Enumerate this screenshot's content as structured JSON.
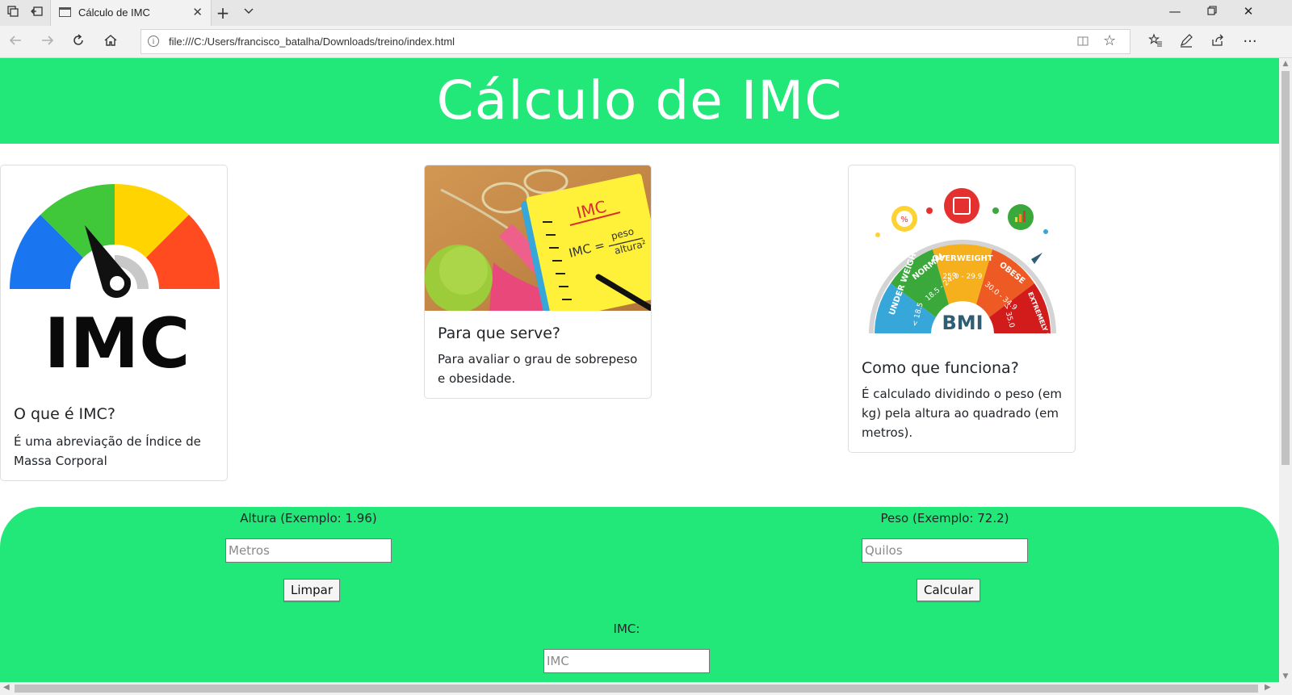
{
  "browser": {
    "tab_title": "Cálculo de IMC",
    "url": "file:///C:/Users/francisco_batalha/Downloads/treino/index.html"
  },
  "page": {
    "title": "Cálculo de IMC",
    "cards": [
      {
        "image_text": "IMC",
        "title": "O que é IMC?",
        "text": "É uma abreviação de Índice de Massa Corporal"
      },
      {
        "image_text": "IMC",
        "image_formula_left": "IMC =",
        "image_formula_num": "peso",
        "image_formula_den": "altura²",
        "title": "Para que serve?",
        "text": "Para avaliar o grau de sobrepeso e obesidade."
      },
      {
        "image_text": "BMI",
        "image_segments": [
          "UNDER WEIGHT",
          "NORMAL",
          "OVERWEIGHT",
          "OBESE",
          "EXTREMELY OBESE"
        ],
        "image_ranges": [
          "< 18.5",
          "18.5 - 24.9",
          "25.0 - 29.9",
          "30.0 - 34.9",
          "> 35.0"
        ],
        "title": "Como que funciona?",
        "text": "É calculado dividindo o peso (em kg) pela altura ao quadrado (em metros)."
      }
    ],
    "form": {
      "height_label": "Altura (Exemplo: 1.96)",
      "height_placeholder": "Metros",
      "weight_label": "Peso (Exemplo: 72.2)",
      "weight_placeholder": "Quilos",
      "clear_label": "Limpar",
      "calc_label": "Calcular",
      "result_label": "IMC:",
      "result_placeholder": "IMC"
    }
  },
  "colors": {
    "brand_green": "#22e87a",
    "chrome_bg": "#f2f2f2"
  }
}
